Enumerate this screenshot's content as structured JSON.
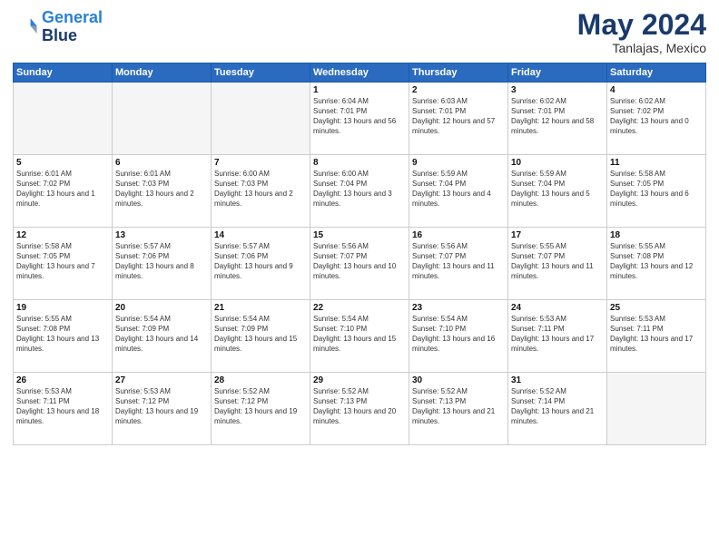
{
  "header": {
    "logo_line1": "General",
    "logo_line2": "Blue",
    "month": "May 2024",
    "location": "Tanlajas, Mexico"
  },
  "weekdays": [
    "Sunday",
    "Monday",
    "Tuesday",
    "Wednesday",
    "Thursday",
    "Friday",
    "Saturday"
  ],
  "weeks": [
    [
      {
        "day": "",
        "info": "",
        "empty": true
      },
      {
        "day": "",
        "info": "",
        "empty": true
      },
      {
        "day": "",
        "info": "",
        "empty": true
      },
      {
        "day": "1",
        "info": "Sunrise: 6:04 AM\nSunset: 7:01 PM\nDaylight: 13 hours and 56 minutes."
      },
      {
        "day": "2",
        "info": "Sunrise: 6:03 AM\nSunset: 7:01 PM\nDaylight: 12 hours and 57 minutes."
      },
      {
        "day": "3",
        "info": "Sunrise: 6:02 AM\nSunset: 7:01 PM\nDaylight: 12 hours and 58 minutes."
      },
      {
        "day": "4",
        "info": "Sunrise: 6:02 AM\nSunset: 7:02 PM\nDaylight: 13 hours and 0 minutes."
      }
    ],
    [
      {
        "day": "5",
        "info": "Sunrise: 6:01 AM\nSunset: 7:02 PM\nDaylight: 13 hours and 1 minute."
      },
      {
        "day": "6",
        "info": "Sunrise: 6:01 AM\nSunset: 7:03 PM\nDaylight: 13 hours and 2 minutes."
      },
      {
        "day": "7",
        "info": "Sunrise: 6:00 AM\nSunset: 7:03 PM\nDaylight: 13 hours and 2 minutes."
      },
      {
        "day": "8",
        "info": "Sunrise: 6:00 AM\nSunset: 7:04 PM\nDaylight: 13 hours and 3 minutes."
      },
      {
        "day": "9",
        "info": "Sunrise: 5:59 AM\nSunset: 7:04 PM\nDaylight: 13 hours and 4 minutes."
      },
      {
        "day": "10",
        "info": "Sunrise: 5:59 AM\nSunset: 7:04 PM\nDaylight: 13 hours and 5 minutes."
      },
      {
        "day": "11",
        "info": "Sunrise: 5:58 AM\nSunset: 7:05 PM\nDaylight: 13 hours and 6 minutes."
      }
    ],
    [
      {
        "day": "12",
        "info": "Sunrise: 5:58 AM\nSunset: 7:05 PM\nDaylight: 13 hours and 7 minutes."
      },
      {
        "day": "13",
        "info": "Sunrise: 5:57 AM\nSunset: 7:06 PM\nDaylight: 13 hours and 8 minutes."
      },
      {
        "day": "14",
        "info": "Sunrise: 5:57 AM\nSunset: 7:06 PM\nDaylight: 13 hours and 9 minutes."
      },
      {
        "day": "15",
        "info": "Sunrise: 5:56 AM\nSunset: 7:07 PM\nDaylight: 13 hours and 10 minutes."
      },
      {
        "day": "16",
        "info": "Sunrise: 5:56 AM\nSunset: 7:07 PM\nDaylight: 13 hours and 11 minutes."
      },
      {
        "day": "17",
        "info": "Sunrise: 5:55 AM\nSunset: 7:07 PM\nDaylight: 13 hours and 11 minutes."
      },
      {
        "day": "18",
        "info": "Sunrise: 5:55 AM\nSunset: 7:08 PM\nDaylight: 13 hours and 12 minutes."
      }
    ],
    [
      {
        "day": "19",
        "info": "Sunrise: 5:55 AM\nSunset: 7:08 PM\nDaylight: 13 hours and 13 minutes."
      },
      {
        "day": "20",
        "info": "Sunrise: 5:54 AM\nSunset: 7:09 PM\nDaylight: 13 hours and 14 minutes."
      },
      {
        "day": "21",
        "info": "Sunrise: 5:54 AM\nSunset: 7:09 PM\nDaylight: 13 hours and 15 minutes."
      },
      {
        "day": "22",
        "info": "Sunrise: 5:54 AM\nSunset: 7:10 PM\nDaylight: 13 hours and 15 minutes."
      },
      {
        "day": "23",
        "info": "Sunrise: 5:54 AM\nSunset: 7:10 PM\nDaylight: 13 hours and 16 minutes."
      },
      {
        "day": "24",
        "info": "Sunrise: 5:53 AM\nSunset: 7:11 PM\nDaylight: 13 hours and 17 minutes."
      },
      {
        "day": "25",
        "info": "Sunrise: 5:53 AM\nSunset: 7:11 PM\nDaylight: 13 hours and 17 minutes."
      }
    ],
    [
      {
        "day": "26",
        "info": "Sunrise: 5:53 AM\nSunset: 7:11 PM\nDaylight: 13 hours and 18 minutes."
      },
      {
        "day": "27",
        "info": "Sunrise: 5:53 AM\nSunset: 7:12 PM\nDaylight: 13 hours and 19 minutes."
      },
      {
        "day": "28",
        "info": "Sunrise: 5:52 AM\nSunset: 7:12 PM\nDaylight: 13 hours and 19 minutes."
      },
      {
        "day": "29",
        "info": "Sunrise: 5:52 AM\nSunset: 7:13 PM\nDaylight: 13 hours and 20 minutes."
      },
      {
        "day": "30",
        "info": "Sunrise: 5:52 AM\nSunset: 7:13 PM\nDaylight: 13 hours and 21 minutes."
      },
      {
        "day": "31",
        "info": "Sunrise: 5:52 AM\nSunset: 7:14 PM\nDaylight: 13 hours and 21 minutes."
      },
      {
        "day": "",
        "info": "",
        "empty": true
      }
    ]
  ]
}
